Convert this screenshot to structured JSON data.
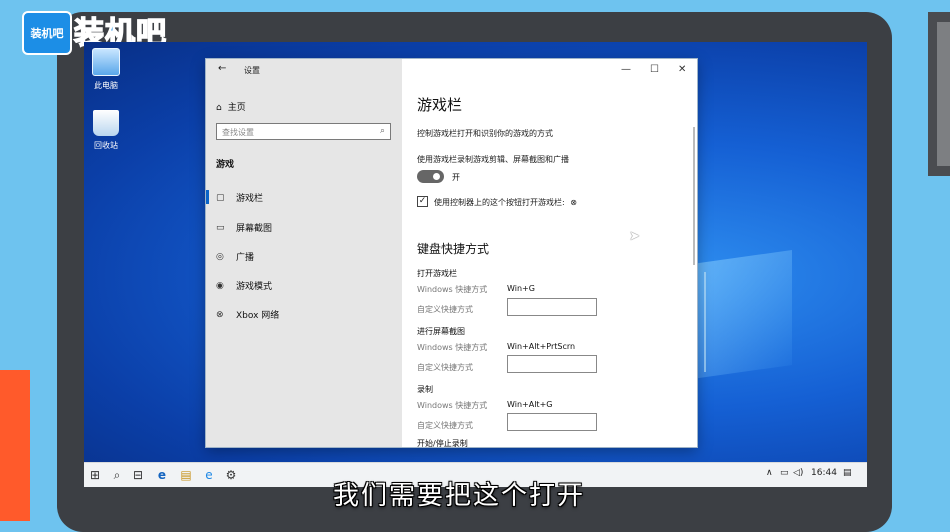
{
  "logo": {
    "badge_text": "装机吧",
    "title": "装机吧"
  },
  "desktop": {
    "icons": [
      {
        "label": "此电脑",
        "icon": "computer-icon"
      },
      {
        "label": "回收站",
        "icon": "recycle-bin-icon"
      }
    ]
  },
  "window": {
    "back_glyph": "←",
    "title": "设置",
    "controls": {
      "minimize": "—",
      "maximize": "☐",
      "close": "✕"
    },
    "sidebar": {
      "home_label": "主页",
      "search_placeholder": "查找设置",
      "section_title": "游戏",
      "items": [
        {
          "label": "游戏栏",
          "icon": "game-bar-icon",
          "glyph": "▢",
          "active": true
        },
        {
          "label": "屏幕截图",
          "icon": "screenshot-icon",
          "glyph": "▭"
        },
        {
          "label": "广播",
          "icon": "broadcast-icon",
          "glyph": "◎"
        },
        {
          "label": "游戏模式",
          "icon": "game-mode-icon",
          "glyph": "◉"
        },
        {
          "label": "Xbox 网络",
          "icon": "xbox-icon",
          "glyph": "⊗"
        }
      ]
    },
    "content": {
      "title": "游戏栏",
      "description": "控制游戏栏打开和识别你的游戏的方式",
      "toggle_label": "使用游戏栏录制游戏剪辑、屏幕截图和广播",
      "toggle_state": "开",
      "checkbox_label": "使用控制器上的这个按钮打开游戏栏:",
      "shortcuts_title": "键盘快捷方式",
      "groups": [
        {
          "name": "打开游戏栏",
          "windows_label": "Windows 快捷方式",
          "windows_value": "Win+G",
          "custom_label": "自定义快捷方式"
        },
        {
          "name": "进行屏幕截图",
          "windows_label": "Windows 快捷方式",
          "windows_value": "Win+Alt+PrtScrn",
          "custom_label": "自定义快捷方式"
        },
        {
          "name": "录制",
          "windows_label": "Windows 快捷方式",
          "windows_value": "Win+Alt+G",
          "custom_label": "自定义快捷方式"
        }
      ],
      "cut_off_text": "开始/停止录制"
    }
  },
  "taskbar": {
    "items": [
      "⊞",
      "⌕",
      "⊟",
      "e",
      "▤",
      "e",
      "⚙"
    ],
    "tray_arrow": "∧",
    "time": "16:44"
  },
  "caption": "我们需要把这个打开"
}
